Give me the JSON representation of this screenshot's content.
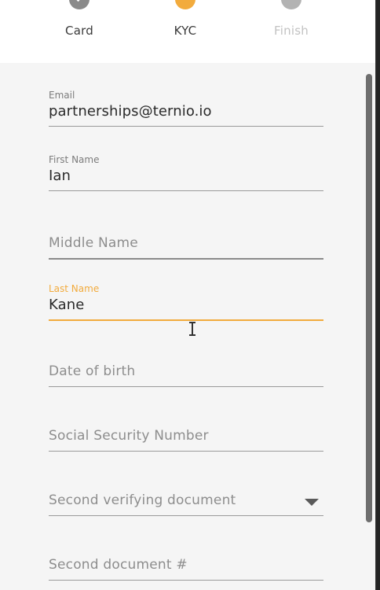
{
  "stepper": {
    "steps": [
      {
        "label": "Card",
        "state": "completed"
      },
      {
        "label": "KYC",
        "state": "active"
      },
      {
        "label": "Finish",
        "state": "pending"
      }
    ]
  },
  "form": {
    "email": {
      "label": "Email",
      "value": "partnerships@ternio.io"
    },
    "first_name": {
      "label": "First Name",
      "value": "Ian"
    },
    "middle_name": {
      "placeholder": "Middle Name"
    },
    "last_name": {
      "label": "Last Name",
      "value": "Kane"
    },
    "date_of_birth": {
      "placeholder": "Date of birth"
    },
    "ssn": {
      "placeholder": "Social Security Number"
    },
    "second_document": {
      "placeholder": "Second verifying document"
    },
    "second_document_number": {
      "placeholder": "Second document #"
    }
  },
  "colors": {
    "accent": "#f2ab3d",
    "completed": "#8a8a8a",
    "pending": "#b3b3b3",
    "panel_bg": "#f5f5f5"
  }
}
